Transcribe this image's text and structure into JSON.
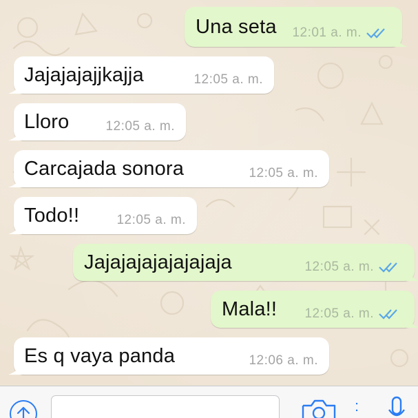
{
  "messages": [
    {
      "text": "Una seta",
      "time": "12:01 a. m.",
      "direction": "out",
      "read": true
    },
    {
      "text": "Jajajajajjkajja",
      "time": "12:05 a. m.",
      "direction": "in"
    },
    {
      "text": "Lloro",
      "time": "12:05 a. m.",
      "direction": "in"
    },
    {
      "text": "Carcajada sonora",
      "time": "12:05 a. m.",
      "direction": "in"
    },
    {
      "text": "Todo!!",
      "time": "12:05 a. m.",
      "direction": "in"
    },
    {
      "text": "Jajajajajajajajaja",
      "time": "12:05 a. m.",
      "direction": "out",
      "read": true
    },
    {
      "text": "Mala!!",
      "time": "12:05 a. m.",
      "direction": "out",
      "read": true
    },
    {
      "text": "Es q vaya panda",
      "time": "12:06 a. m.",
      "direction": "in"
    }
  ],
  "composer": {
    "input_value": "",
    "separator": ":"
  },
  "icons": {
    "upload": "upload-icon",
    "camera": "camera-icon",
    "mic": "microphone-icon",
    "read_receipt": "double-check-icon"
  },
  "colors": {
    "outgoing_bubble": "#e2f7cb",
    "incoming_bubble": "#ffffff",
    "read_ticks": "#5aa7e8",
    "accent": "#2b7df3",
    "wallpaper": "#eee3d3"
  }
}
